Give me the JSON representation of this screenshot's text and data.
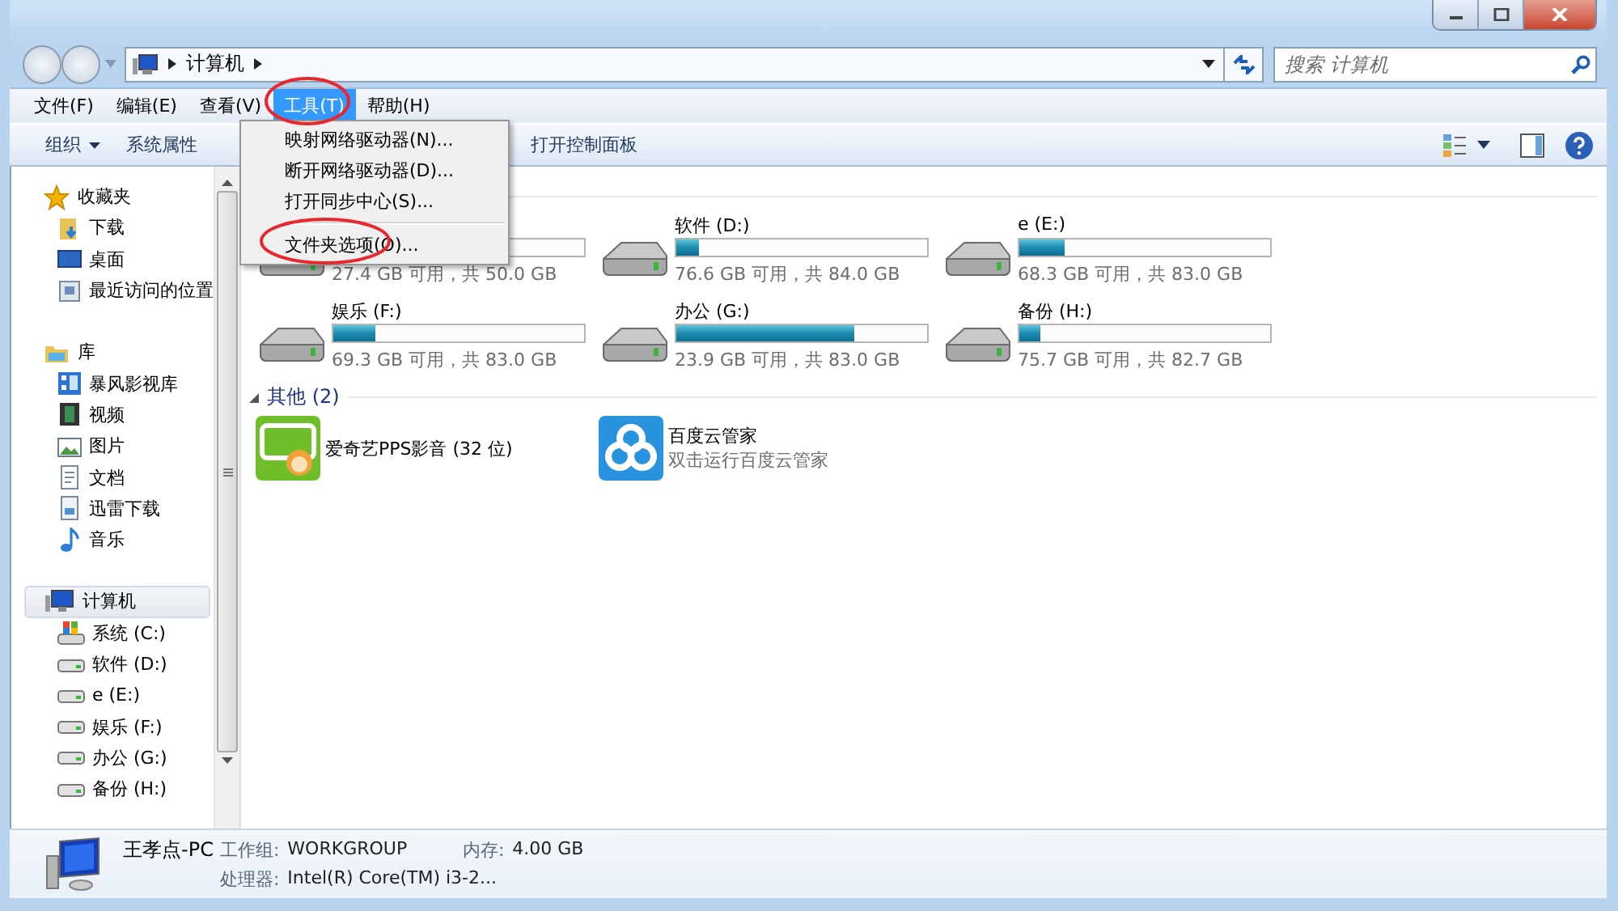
{
  "address": {
    "path": [
      "计算机"
    ]
  },
  "search": {
    "placeholder": "搜索 计算机"
  },
  "menubar": [
    {
      "label": "文件(F)",
      "selected": false
    },
    {
      "label": "编辑(E)",
      "selected": false
    },
    {
      "label": "查看(V)",
      "selected": false
    },
    {
      "label": "工具(T)",
      "selected": true
    },
    {
      "label": "帮助(H)",
      "selected": false
    }
  ],
  "menu": {
    "items": [
      {
        "kind": "item",
        "label": "映射网络驱动器(N)..."
      },
      {
        "kind": "item",
        "label": "断开网络驱动器(D)..."
      },
      {
        "kind": "item",
        "label": "打开同步中心(S)..."
      },
      {
        "kind": "separator"
      },
      {
        "kind": "item",
        "label": "文件夹选项(O)..."
      }
    ]
  },
  "toolbar": [
    {
      "kind": "dropdown",
      "label": "组织"
    },
    {
      "kind": "button",
      "label": "系统属性"
    },
    {
      "kind": "button",
      "label": "打开控制面板"
    }
  ],
  "sidebar": {
    "groups": [
      {
        "label": "收藏夹",
        "kind": "favorites",
        "selected": false,
        "children": [
          {
            "label": "下载",
            "kind": "downloads",
            "selected": false
          },
          {
            "label": "桌面",
            "kind": "desktop",
            "selected": false
          },
          {
            "label": "最近访问的位置",
            "kind": "recent",
            "selected": false
          }
        ]
      },
      {
        "label": "库",
        "kind": "library",
        "selected": false,
        "children": [
          {
            "label": "暴风影视库",
            "kind": "video-library",
            "selected": false
          },
          {
            "label": "视频",
            "kind": "video",
            "selected": false
          },
          {
            "label": "图片",
            "kind": "pictures",
            "selected": false
          },
          {
            "label": "文档",
            "kind": "documents",
            "selected": false
          },
          {
            "label": "迅雷下载",
            "kind": "download-folder",
            "selected": false
          },
          {
            "label": "音乐",
            "kind": "music",
            "selected": false
          }
        ]
      },
      {
        "label": "计算机",
        "kind": "computer",
        "selected": true,
        "children": [
          {
            "label": "系统 (C:)",
            "kind": "system-drive",
            "selected": false
          },
          {
            "label": "软件 (D:)",
            "kind": "drive",
            "selected": false
          },
          {
            "label": "e (E:)",
            "kind": "drive",
            "selected": false
          },
          {
            "label": "娱乐 (F:)",
            "kind": "drive",
            "selected": false
          },
          {
            "label": "办公 (G:)",
            "kind": "drive",
            "selected": false
          },
          {
            "label": "备份 (H:)",
            "kind": "drive",
            "selected": false
          }
        ]
      }
    ]
  },
  "drives": [
    {
      "free": "27.4 GB 可用，共 50.0 GB"
    },
    {
      "name": "软件 (D:)",
      "free": "76.6 GB 可用，共 84.0 GB",
      "level": 0.09
    },
    {
      "name": "e (E:)",
      "free": "68.3 GB 可用，共 83.0 GB",
      "level": 0.18
    },
    {
      "name": "娱乐 (F:)",
      "free": "69.3 GB 可用，共 83.0 GB",
      "level": 0.165
    },
    {
      "name": "办公 (G:)",
      "free": "23.9 GB 可用，共 83.0 GB",
      "level": 0.71
    },
    {
      "name": "备份 (H:)",
      "free": "75.7 GB 可用，共 82.7 GB",
      "level": 0.085
    }
  ],
  "others": {
    "title": "其他 (2)",
    "expanded": true,
    "items": [
      {
        "kind": "iqiyi",
        "name": "爱奇艺PPS影音 (32 位)"
      },
      {
        "kind": "baidu-cloud",
        "name": "百度云管家",
        "subtitle": "双击运行百度云管家"
      }
    ]
  },
  "details": {
    "name": "王孝点-PC",
    "fields": [
      {
        "label": "工作组:",
        "value": "WORKGROUP"
      },
      {
        "label": "内存:",
        "value": "4.00 GB"
      },
      {
        "label": "处理器:",
        "value": "Intel(R) Core(TM) i3-2..."
      }
    ]
  },
  "annotations": [
    {
      "kind": "ellipse"
    },
    {
      "kind": "ellipse"
    }
  ]
}
